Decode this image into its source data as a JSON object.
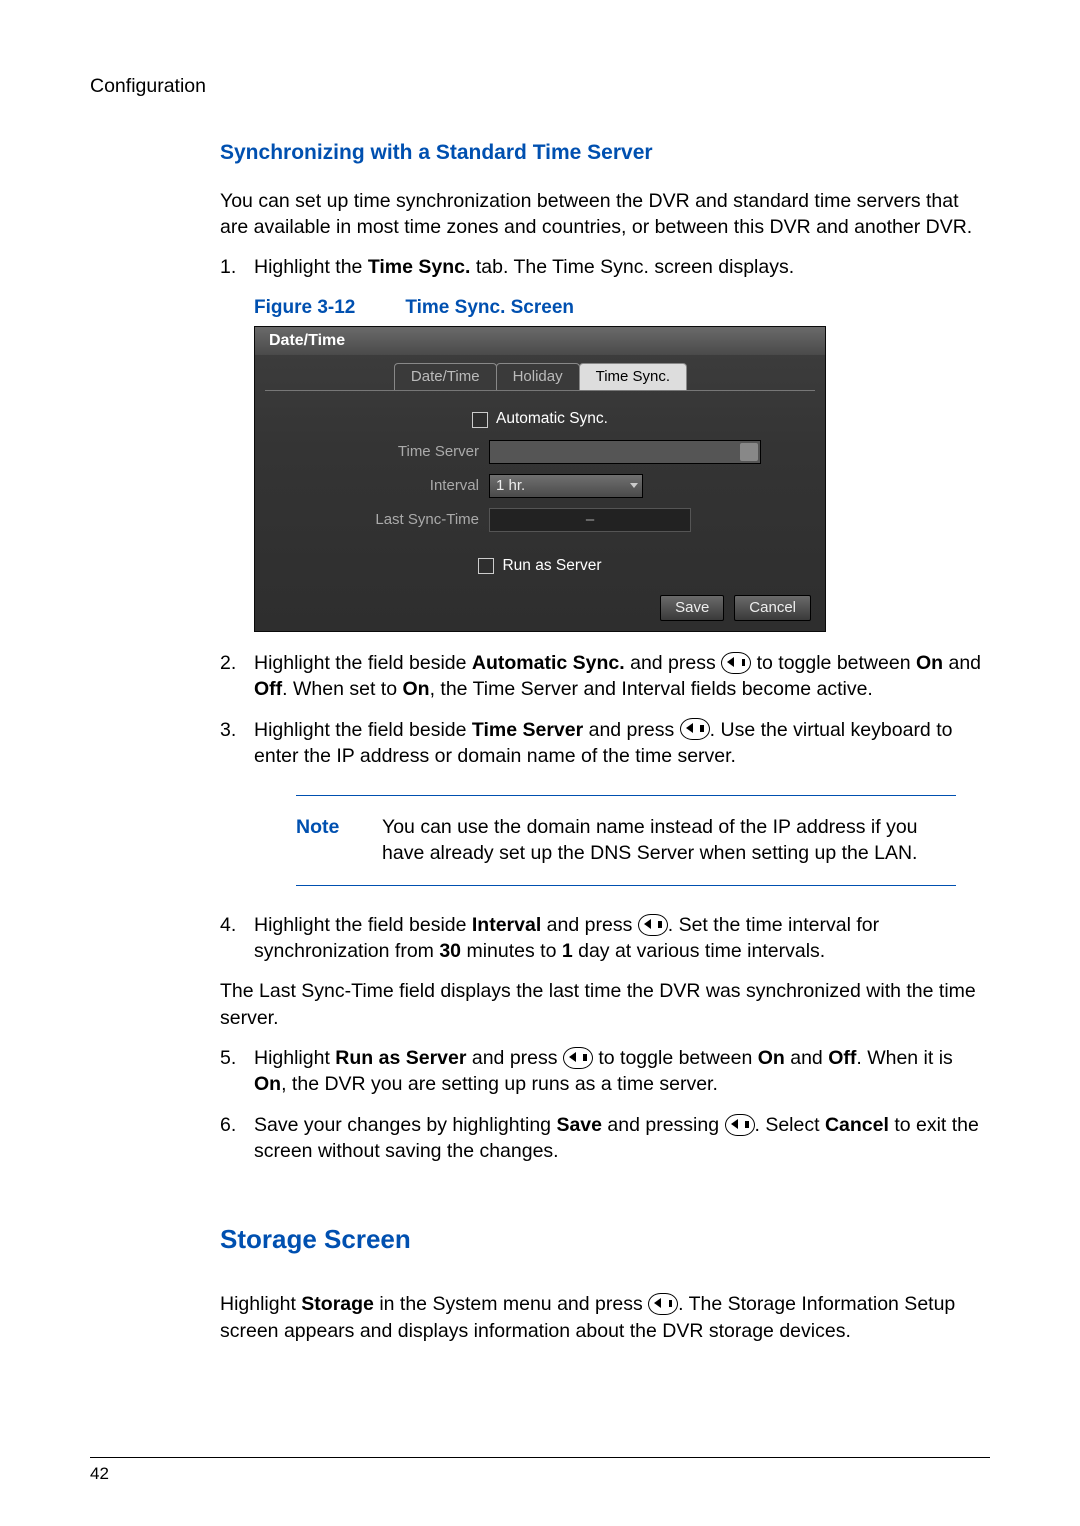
{
  "header": {
    "section": "Configuration"
  },
  "sync": {
    "heading": "Synchronizing with a Standard Time Server",
    "intro": "You can set up time synchronization between the DVR and standard time servers that are available in most time zones and countries, or between this DVR and another DVR.",
    "step1_a": "Highlight the ",
    "step1_b": "Time Sync.",
    "step1_c": " tab. The Time Sync. screen displays.",
    "fig_num": "Figure 3-12",
    "fig_title": "Time Sync. Screen",
    "dialog": {
      "title": "Date/Time",
      "tabs": {
        "datetime": "Date/Time",
        "holiday": "Holiday",
        "timesync": "Time Sync."
      },
      "auto_sync": "Automatic Sync.",
      "time_server_label": "Time Server",
      "time_server_value": "",
      "interval_label": "Interval",
      "interval_value": "1 hr.",
      "last_sync_label": "Last Sync-Time",
      "last_sync_value": "–",
      "run_as_server": "Run as Server",
      "save": "Save",
      "cancel": "Cancel"
    },
    "step2_a": "Highlight the field beside ",
    "step2_b": "Automatic Sync.",
    "step2_c": " and press ",
    "step2_d": " to toggle between ",
    "step2_e": "On",
    "step2_f": " and ",
    "step2_g": "Off",
    "step2_h": ". When set to ",
    "step2_i": "On",
    "step2_j": ", the Time Server and Interval fields become active.",
    "step3_a": "Highlight the field beside ",
    "step3_b": "Time Server",
    "step3_c": " and press ",
    "step3_d": ". Use the virtual keyboard to enter the IP address or domain name of the time server.",
    "note_label": "Note",
    "note_body": "You can use the domain name instead of the IP address if you have already set up the DNS Server when setting up the LAN.",
    "step4_a": "Highlight the field beside ",
    "step4_b": "Interval",
    "step4_c": " and press ",
    "step4_d": ". Set the time interval for synchronization from ",
    "step4_e": "30",
    "step4_f": " minutes to ",
    "step4_g": "1",
    "step4_h": " day at various time intervals.",
    "last_sync_para": "The Last Sync-Time field displays the last time the DVR was synchronized with the time server.",
    "step5_a": "Highlight ",
    "step5_b": "Run as Server",
    "step5_c": " and press ",
    "step5_d": " to toggle between ",
    "step5_e": "On",
    "step5_f": " and ",
    "step5_g": "Off",
    "step5_h": ". When it is ",
    "step5_i": "On",
    "step5_j": ", the DVR you are setting up runs as a time server.",
    "step6_a": "Save your changes by highlighting ",
    "step6_b": "Save",
    "step6_c": " and pressing ",
    "step6_d": ". Select ",
    "step6_e": "Cancel",
    "step6_f": " to exit the screen without saving the changes."
  },
  "storage": {
    "heading": "Storage Screen",
    "para_a": "Highlight ",
    "para_b": "Storage",
    "para_c": " in the System menu and press ",
    "para_d": ". The Storage Information Setup screen appears and displays information about the DVR storage devices."
  },
  "page_number": "42"
}
